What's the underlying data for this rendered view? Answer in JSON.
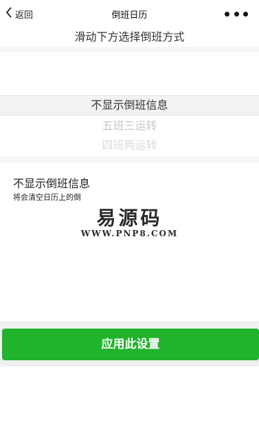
{
  "nav": {
    "back_label": "返回",
    "title": "倒班日历",
    "back_icon": "chevron-left-icon",
    "more_icon": "more-dots-icon"
  },
  "hint": "滑动下方选择倒班方式",
  "picker": {
    "selected": "不显示倒班信息",
    "options_below": [
      "五班三运转",
      "四班两运转"
    ]
  },
  "description": {
    "title": "不显示倒班信息",
    "subtitle": "将会清空日历上的倒"
  },
  "watermark": {
    "cn": "易源码",
    "en": "WWW.PNP8.COM"
  },
  "apply_button": "应用此设置",
  "colors": {
    "accent_green": "#21b32b",
    "background": "#f6f6f6"
  }
}
